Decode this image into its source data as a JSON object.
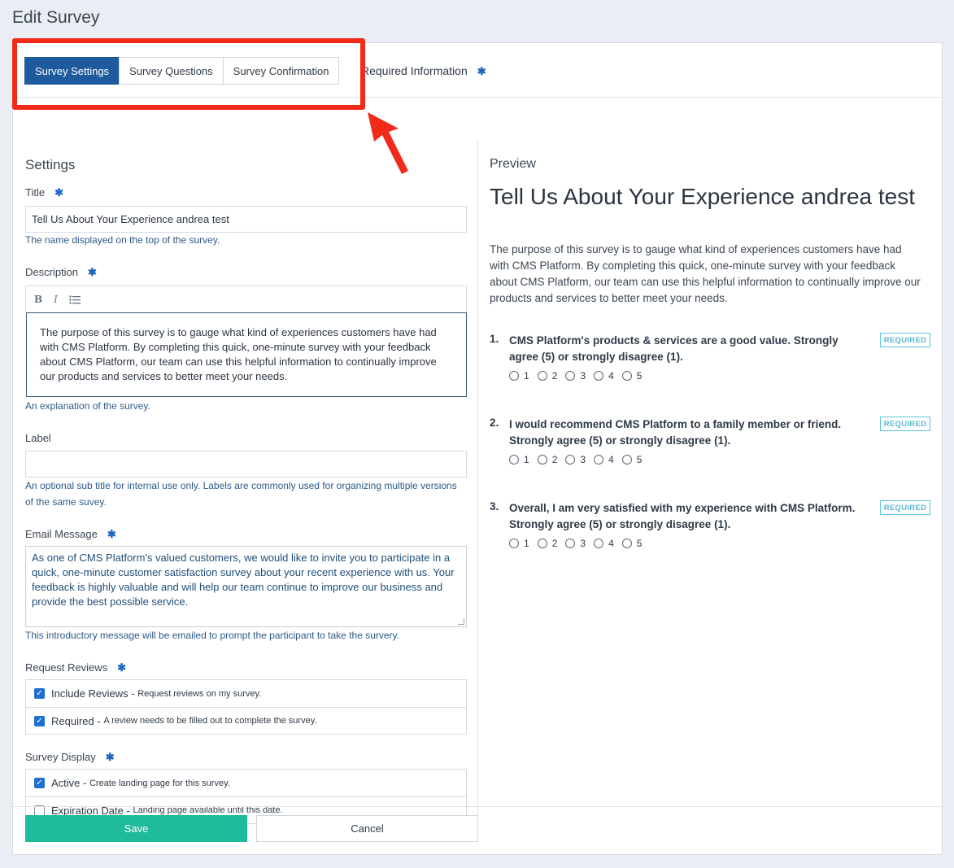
{
  "page_title": "Edit Survey",
  "tabs": [
    {
      "label": "Survey Settings",
      "active": true
    },
    {
      "label": "Survey Questions",
      "active": false
    },
    {
      "label": "Survey Confirmation",
      "active": false
    }
  ],
  "required_info_label": "Required Information",
  "required_marker": "✱",
  "settings": {
    "heading": "Settings",
    "title": {
      "label": "Title",
      "value": "Tell Us About Your Experience andrea test",
      "help": "The name displayed on the top of the survey."
    },
    "description": {
      "label": "Description",
      "toolbar": {
        "bold": "B",
        "italic": "I",
        "list_icon": "list-icon"
      },
      "value": "The purpose of this survey is to gauge what kind of experiences customers have had with CMS Platform. By completing this quick, one-minute survey with your feedback about CMS Platform, our team can use this helpful information to continually improve our products and services to better meet your needs.",
      "help": "An explanation of the survey."
    },
    "label_field": {
      "label": "Label",
      "value": "",
      "help": "An optional sub title for internal use only. Labels are commonly used for organizing multiple versions of the same suvey."
    },
    "email_message": {
      "label": "Email Message",
      "value": "As one of CMS Platform's valued customers, we would like to invite you to participate in a quick, one-minute customer satisfaction survey about your recent experience with us. Your feedback is highly valuable and will help our team continue to improve our business and provide the best possible service.",
      "help": "This introductory message will be emailed to prompt the participant to take the survery."
    },
    "request_reviews": {
      "label": "Request Reviews",
      "options": [
        {
          "label": "Include Reviews",
          "desc": "Request reviews on my survey.",
          "checked": true
        },
        {
          "label": "Required",
          "desc": "A review needs to be filled out to complete the survey.",
          "checked": true
        }
      ]
    },
    "survey_display": {
      "label": "Survey Display",
      "options": [
        {
          "label": "Active",
          "desc": "Create landing page for this survey.",
          "checked": true
        },
        {
          "label": "Expiration Date",
          "desc": "Landing page available until this date.",
          "checked": false
        }
      ]
    }
  },
  "preview": {
    "heading": "Preview",
    "title": "Tell Us About Your Experience andrea test",
    "description": "The purpose of this survey is to gauge what kind of experiences customers have had with CMS Platform. By completing this quick, one-minute survey with your feedback about CMS Platform, our team can use this helpful information to continually improve our products and services to better meet your needs.",
    "required_badge": "REQUIRED",
    "questions": [
      {
        "num": "1.",
        "text": "CMS Platform's products & services are a good value. Strongly agree (5) or strongly disagree (1).",
        "options": [
          "1",
          "2",
          "3",
          "4",
          "5"
        ]
      },
      {
        "num": "2.",
        "text": "I would recommend CMS Platform to a family member or friend. Strongly agree (5) or strongly disagree (1).",
        "options": [
          "1",
          "2",
          "3",
          "4",
          "5"
        ]
      },
      {
        "num": "3.",
        "text": "Overall, I am very satisfied with my experience with CMS Platform. Strongly agree (5) or strongly disagree (1).",
        "options": [
          "1",
          "2",
          "3",
          "4",
          "5"
        ]
      }
    ]
  },
  "buttons": {
    "save": "Save",
    "cancel": "Cancel"
  },
  "colors": {
    "tab_active": "#1d5a9e",
    "save": "#1fbb9b",
    "highlight": "#f12a1a",
    "badge": "#5fc3dc"
  }
}
